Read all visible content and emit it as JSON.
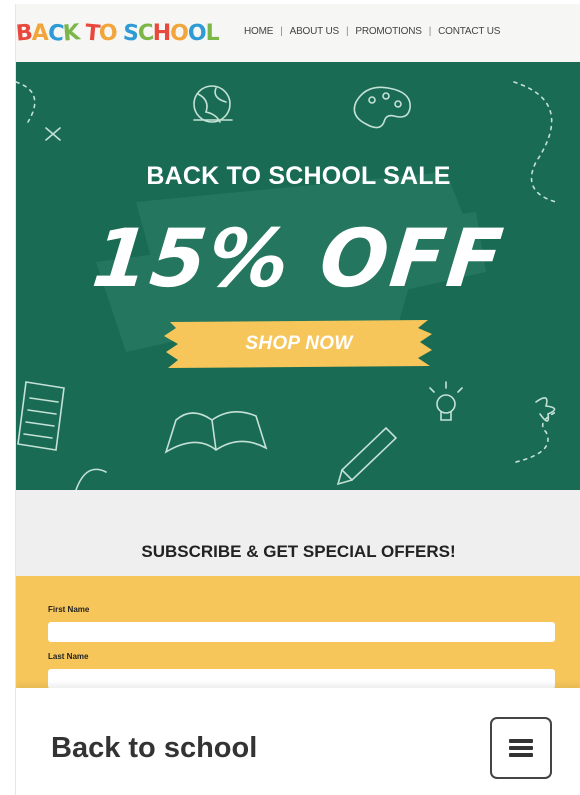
{
  "header": {
    "logo_letters": [
      "B",
      "A",
      "C",
      "K",
      " ",
      "T",
      "O",
      " ",
      "S",
      "C",
      "H",
      "O",
      "O",
      "L"
    ],
    "logo_colors": [
      "#e8493c",
      "#f2a53a",
      "#2e9bd6",
      "#7ab648",
      "#ffffff",
      "#e8493c",
      "#f2a53a",
      "#ffffff",
      "#2e9bd6",
      "#7ab648",
      "#e8493c",
      "#f2a53a",
      "#2e9bd6",
      "#7ab648"
    ],
    "nav": [
      {
        "label": "HOME"
      },
      {
        "label": "ABOUT US"
      },
      {
        "label": "PROMOTIONS"
      },
      {
        "label": "CONTACT US"
      }
    ],
    "nav_separator": "|"
  },
  "hero": {
    "title": "BACK TO SCHOOL SALE",
    "discount": "15% OFF",
    "cta": "SHOP NOW",
    "background_color": "#196b53",
    "cta_color": "#f7c65a"
  },
  "subscribe": {
    "title": "SUBSCRIBE & GET SPECIAL OFFERS!",
    "form_color": "#f7c65a",
    "first_name_label": "First Name",
    "first_name_value": "",
    "last_name_label": "Last Name",
    "last_name_value": ""
  },
  "bottom_bar": {
    "title": "Back to school",
    "menu_icon": "hamburger-menu-icon"
  }
}
